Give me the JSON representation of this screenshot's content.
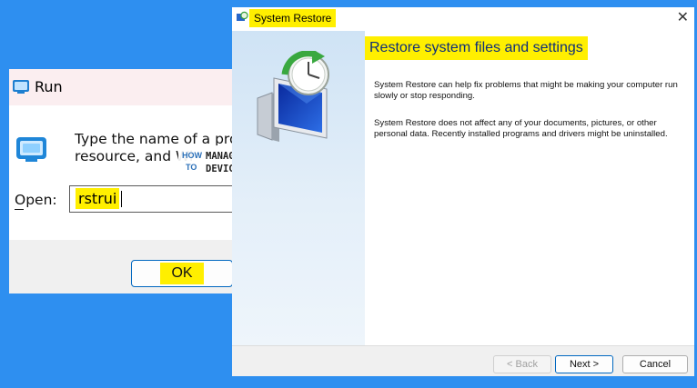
{
  "colors": {
    "desktop": "#2e8ff0",
    "highlight": "#ffef00",
    "accent": "#0067c0",
    "heading": "#0d2d7a"
  },
  "run_dialog": {
    "title": "Run",
    "title_icon": "run-icon",
    "description_line1": "Type the name of a progr",
    "description_line2": "resource, and Wi",
    "open_label": "Open:",
    "open_value": "rstrui",
    "ok_label": "OK"
  },
  "watermark": {
    "how": "HOW",
    "to": "TO",
    "manage": "MANAGE",
    "devices": "DEVICES"
  },
  "system_restore": {
    "title": "System Restore",
    "title_icon": "system-restore-icon",
    "close_glyph": "✕",
    "heading": "Restore system files and settings",
    "paragraph1": "System Restore can help fix problems that might be making your computer run slowly or stop responding.",
    "paragraph2": "System Restore does not affect any of your documents, pictures, or other personal data. Recently installed programs and drivers might be uninstalled.",
    "back_label": "< Back",
    "next_label": "Next >",
    "cancel_label": "Cancel"
  }
}
